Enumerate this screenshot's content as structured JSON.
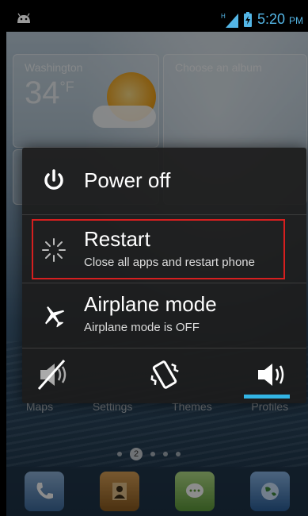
{
  "status_bar": {
    "network": "H",
    "time": "5:20",
    "ampm": "PM"
  },
  "home": {
    "weather": {
      "city": "Washington",
      "temp": "34",
      "unit": "°F"
    },
    "album_label": "Choose an album",
    "app_labels": [
      "Maps",
      "Settings",
      "Themes",
      "Profiles"
    ],
    "page_indicator": {
      "current": "2"
    }
  },
  "power_menu": {
    "power_off": {
      "title": "Power off"
    },
    "restart": {
      "title": "Restart",
      "subtitle": "Close all apps and restart phone"
    },
    "airplane": {
      "title": "Airplane mode",
      "subtitle": "Airplane mode is OFF"
    },
    "sound_modes": {
      "selected": "sound-on"
    }
  },
  "colors": {
    "accent": "#33b5e5",
    "highlight_border": "#d61f1f",
    "dialog_bg": "#1c1c1c"
  }
}
